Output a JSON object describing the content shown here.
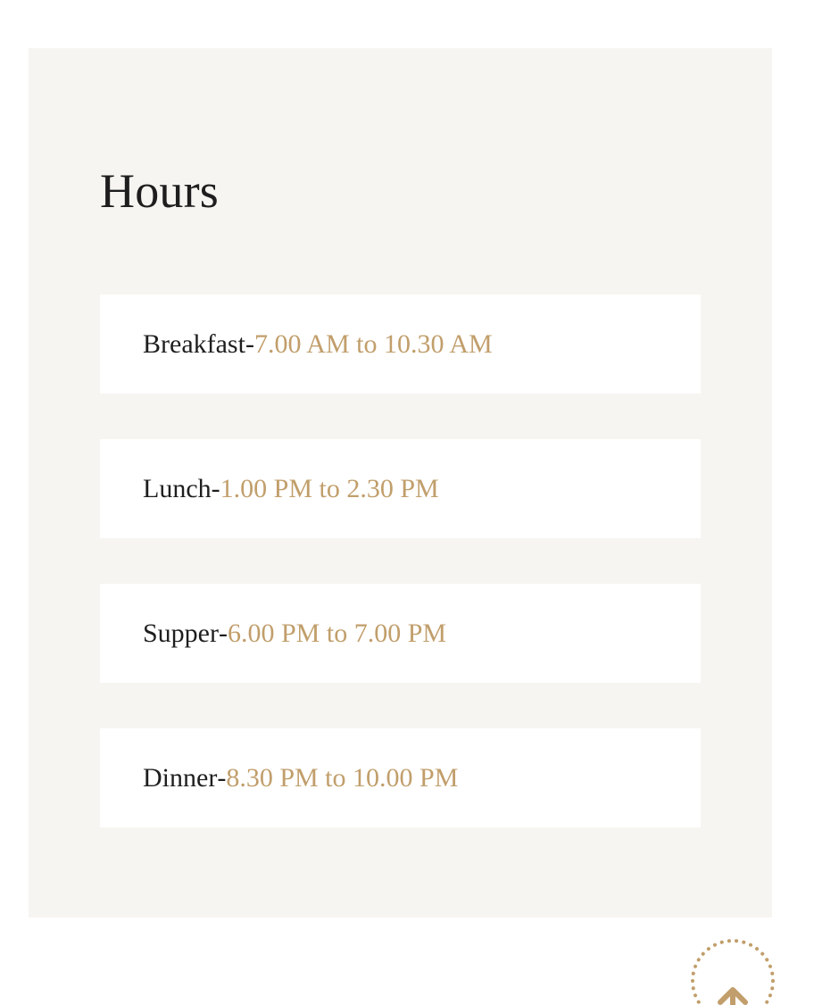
{
  "hours": {
    "title": "Hours",
    "items": [
      {
        "label": "Breakfast",
        "separator": " - ",
        "time": "7.00 AM to 10.30 AM"
      },
      {
        "label": "Lunch",
        "separator": " - ",
        "time": "1.00 PM to 2.30 PM"
      },
      {
        "label": "Supper",
        "separator": " - ",
        "time": "6.00 PM to 7.00 PM"
      },
      {
        "label": "Dinner",
        "separator": " - ",
        "time": "8.30 PM to 10.00 PM"
      }
    ]
  },
  "scroll_top": {
    "icon": "arrow-up-icon"
  },
  "colors": {
    "panel_background": "#f7f5f1",
    "card_background": "#ffffff",
    "text": "#1e1e1e",
    "accent": "#c19e6b"
  }
}
